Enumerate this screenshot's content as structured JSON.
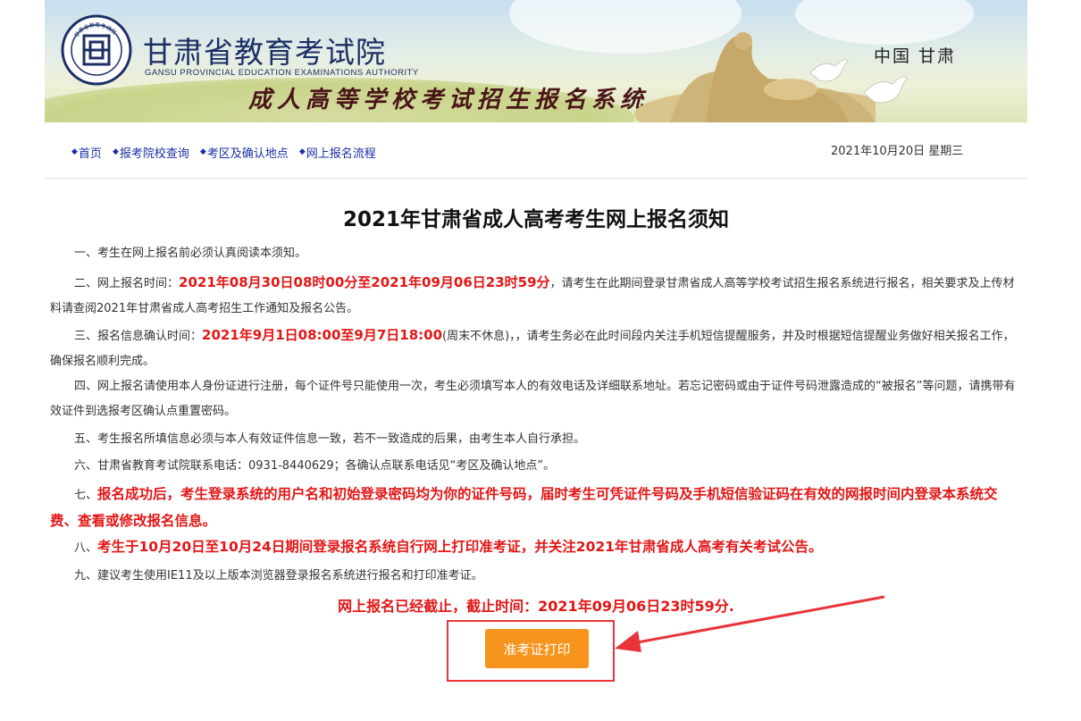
{
  "header": {
    "org_name": "甘肃省教育考试院",
    "org_name_en": "GANSU PROVINCIAL EDUCATION EXAMINATIONS AUTHORITY",
    "system_name": "成人高等学校考试招生报名系统",
    "region": "中国  甘肃",
    "seal_text": "甘肃省教育考试院"
  },
  "nav": {
    "items": [
      {
        "label": "首页"
      },
      {
        "label": "报考院校查询"
      },
      {
        "label": "考区及确认地点"
      },
      {
        "label": "网上报名流程"
      }
    ],
    "date": "2021年10月20日 星期三"
  },
  "notice": {
    "title": "2021年甘肃省成人高考考生网上报名须知",
    "p1": "一、考生在网上报名前必须认真阅读本须知。",
    "p2_prefix": "二、网上报名时间：",
    "p2_time": "2021年08月30日08时00分至2021年09月06日23时59分",
    "p2_suffix": "，请考生在此期间登录甘肃省成人高等学校考试招生报名系统进行报名，相关要求及上传材料请查阅2021年甘肃省成人高考招生工作通知及报名公告。",
    "p3_prefix": "三、报名信息确认时间：",
    "p3_time": "2021年9月1日08:00至9月7日18:00",
    "p3_suffix": "(周末不休息)，，请考生务必在此时间段内关注手机短信提醒服务，并及时根据短信提醒业务做好相关报名工作，确保报名顺利完成。",
    "p4": "四、网上报名请使用本人身份证进行注册，每个证件号只能使用一次，考生必须填写本人的有效电话及详细联系地址。若忘记密码或由于证件号码泄露造成的“被报名”等问题，请携带有效证件到选报考区确认点重置密码。",
    "p5": "五、考生报名所填信息必须与本人有效证件信息一致，若不一致造成的后果，由考生本人自行承担。",
    "p6": "六、甘肃省教育考试院联系电话：0931-8440629；各确认点联系电话见“考区及确认地点”。",
    "p7_prefix": "七、",
    "p7_text": "报名成功后，考生登录系统的用户名和初始登录密码均为你的证件号码，届时考生可凭证件号码及手机短信验证码在有效的网报时间内登录本系统交费、查看或修改报名信息。",
    "p8_prefix": "八、",
    "p8_text": "考生于10月20日至10月24日期间登录报名系统自行网上打印准考证，并关注2021年甘肃省成人高考有关考试公告。",
    "p9": "九、建议考生使用IE11及以上版本浏览器登录报名系统进行报名和打印准考证。"
  },
  "deadline": "网上报名已经截止，截止时间：2021年09月06日23时59分.",
  "print_button": "准考证打印",
  "colors": {
    "nav_link": "#1a2fa6",
    "highlight_red": "#e31616",
    "button_orange": "#f7941d",
    "annotation_red": "#e8353a",
    "org_blue": "#1c2f66"
  }
}
